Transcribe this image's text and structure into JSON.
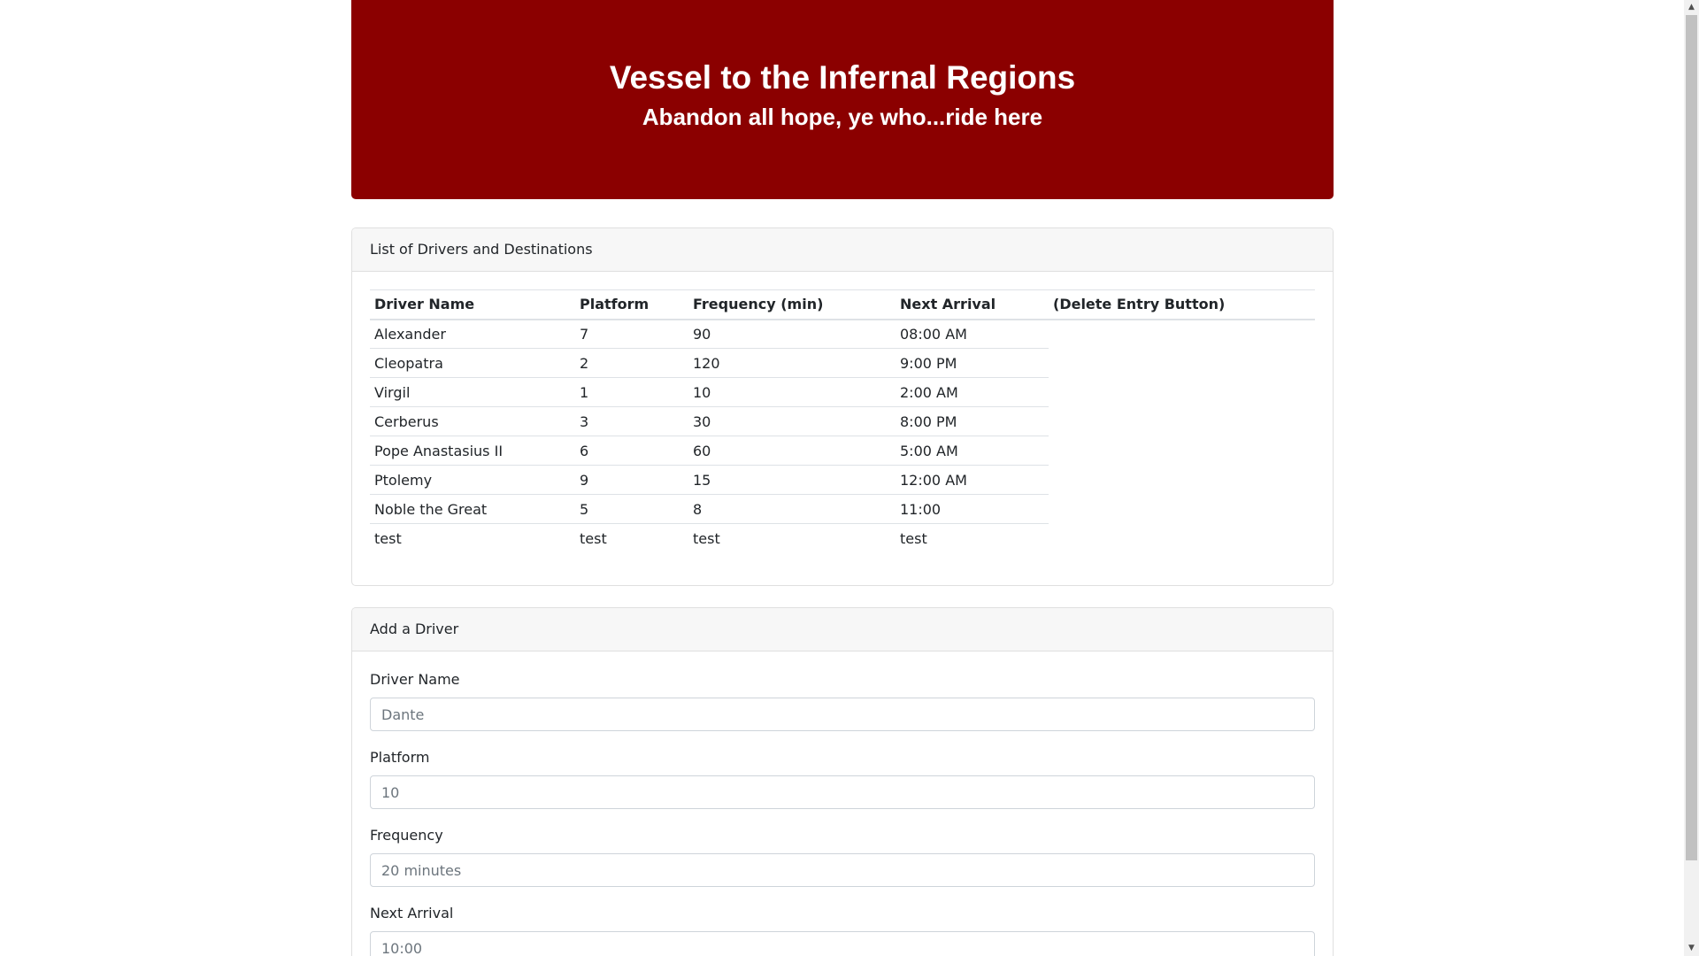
{
  "header": {
    "title": "Vessel to the Infernal Regions",
    "subtitle": "Abandon all hope, ye who...ride here"
  },
  "schedule": {
    "heading": "List of Drivers and Destinations",
    "columns": [
      "Driver Name",
      "Platform",
      "Frequency (min)",
      "Next Arrival",
      "(Delete Entry Button)"
    ],
    "rows": [
      {
        "name": "Alexander",
        "platform": "7",
        "frequency": "90",
        "arrival": "08:00 AM"
      },
      {
        "name": "Cleopatra",
        "platform": "2",
        "frequency": "120",
        "arrival": "9:00 PM"
      },
      {
        "name": "Virgil",
        "platform": "1",
        "frequency": "10",
        "arrival": "2:00 AM"
      },
      {
        "name": "Cerberus",
        "platform": "3",
        "frequency": "30",
        "arrival": "8:00 PM"
      },
      {
        "name": "Pope Anastasius II",
        "platform": "6",
        "frequency": "60",
        "arrival": "5:00 AM"
      },
      {
        "name": "Ptolemy",
        "platform": "9",
        "frequency": "15",
        "arrival": "12:00 AM"
      },
      {
        "name": "Noble the Great",
        "platform": "5",
        "frequency": "8",
        "arrival": "11:00"
      },
      {
        "name": "test",
        "platform": "test",
        "frequency": "test",
        "arrival": "test"
      }
    ]
  },
  "form": {
    "heading": "Add a Driver",
    "fields": {
      "driver_name": {
        "label": "Driver Name",
        "value": "",
        "placeholder": "Dante"
      },
      "platform": {
        "label": "Platform",
        "value": "",
        "placeholder": "10"
      },
      "frequency": {
        "label": "Frequency",
        "value": "",
        "placeholder": "20 minutes"
      },
      "next_arrival": {
        "label": "Next Arrival",
        "value": "",
        "placeholder": "10:00"
      }
    }
  },
  "scrollbar": {
    "up_icon": "triangle-up-icon",
    "down_icon": "triangle-down-icon"
  },
  "colors": {
    "banner": "#8b0000",
    "banner_text": "#ffffff"
  }
}
